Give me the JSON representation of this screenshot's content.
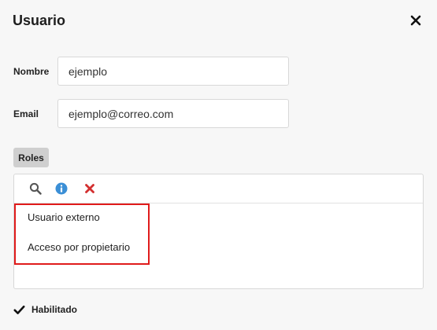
{
  "dialog": {
    "title": "Usuario",
    "close_icon": "close-icon"
  },
  "form": {
    "name_label": "Nombre",
    "name_value": "ejemplo",
    "email_label": "Email",
    "email_value": "ejemplo@correo.com"
  },
  "roles": {
    "tab_label": "Roles",
    "toolbar": [
      {
        "icon": "search-icon",
        "color": "#555555"
      },
      {
        "icon": "info-icon",
        "color": "#3b8fd6"
      },
      {
        "icon": "delete-icon",
        "color": "#d32f2f"
      }
    ],
    "items": [
      "Usuario externo",
      "Acceso por propietario"
    ],
    "highlight_color": "#e01b1b"
  },
  "enabled": {
    "label": "Habilitado",
    "checked": true
  }
}
